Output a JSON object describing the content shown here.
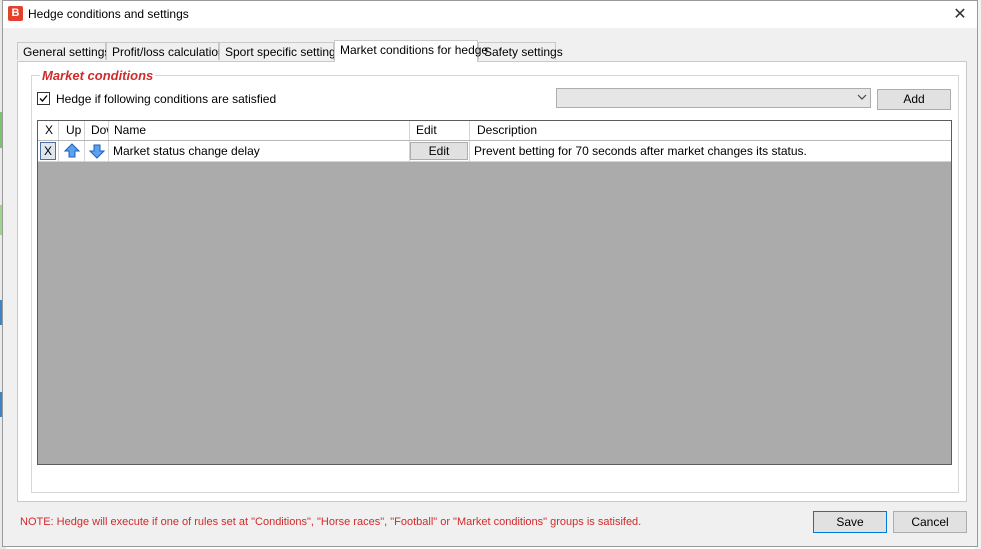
{
  "window": {
    "title": "Hedge conditions and settings",
    "app_icon": "B",
    "close_glyph": "✕"
  },
  "tabs": [
    {
      "label": "General settings",
      "active": false
    },
    {
      "label": "Profit/loss calculation",
      "active": false
    },
    {
      "label": "Sport specific settings",
      "active": false
    },
    {
      "label": "Market conditions for hedge",
      "active": true
    },
    {
      "label": "Safety settings",
      "active": false
    }
  ],
  "group": {
    "title": "Market conditions",
    "checkbox_label": "Hedge if following conditions are satisfied",
    "checkbox_checked": true,
    "combo_value": "",
    "add_label": "Add"
  },
  "grid": {
    "columns": [
      "X",
      "Up",
      "Down",
      "Name",
      "Edit",
      "Description"
    ],
    "rows": [
      {
        "x_label": "X",
        "name": "Market status change delay",
        "edit_label": "Edit",
        "description": "Prevent betting for 70 seconds after market changes its status."
      }
    ]
  },
  "footer": {
    "note": "NOTE: Hedge will execute if one of rules set at \"Conditions\", \"Horse races\", \"Football\" or \"Market conditions\" groups is satisifed.",
    "save_label": "Save",
    "cancel_label": "Cancel"
  },
  "colors": {
    "accent_red": "#d12b2b",
    "grid_bg": "#ababab",
    "arrow_blue": "#1e6fd9"
  }
}
